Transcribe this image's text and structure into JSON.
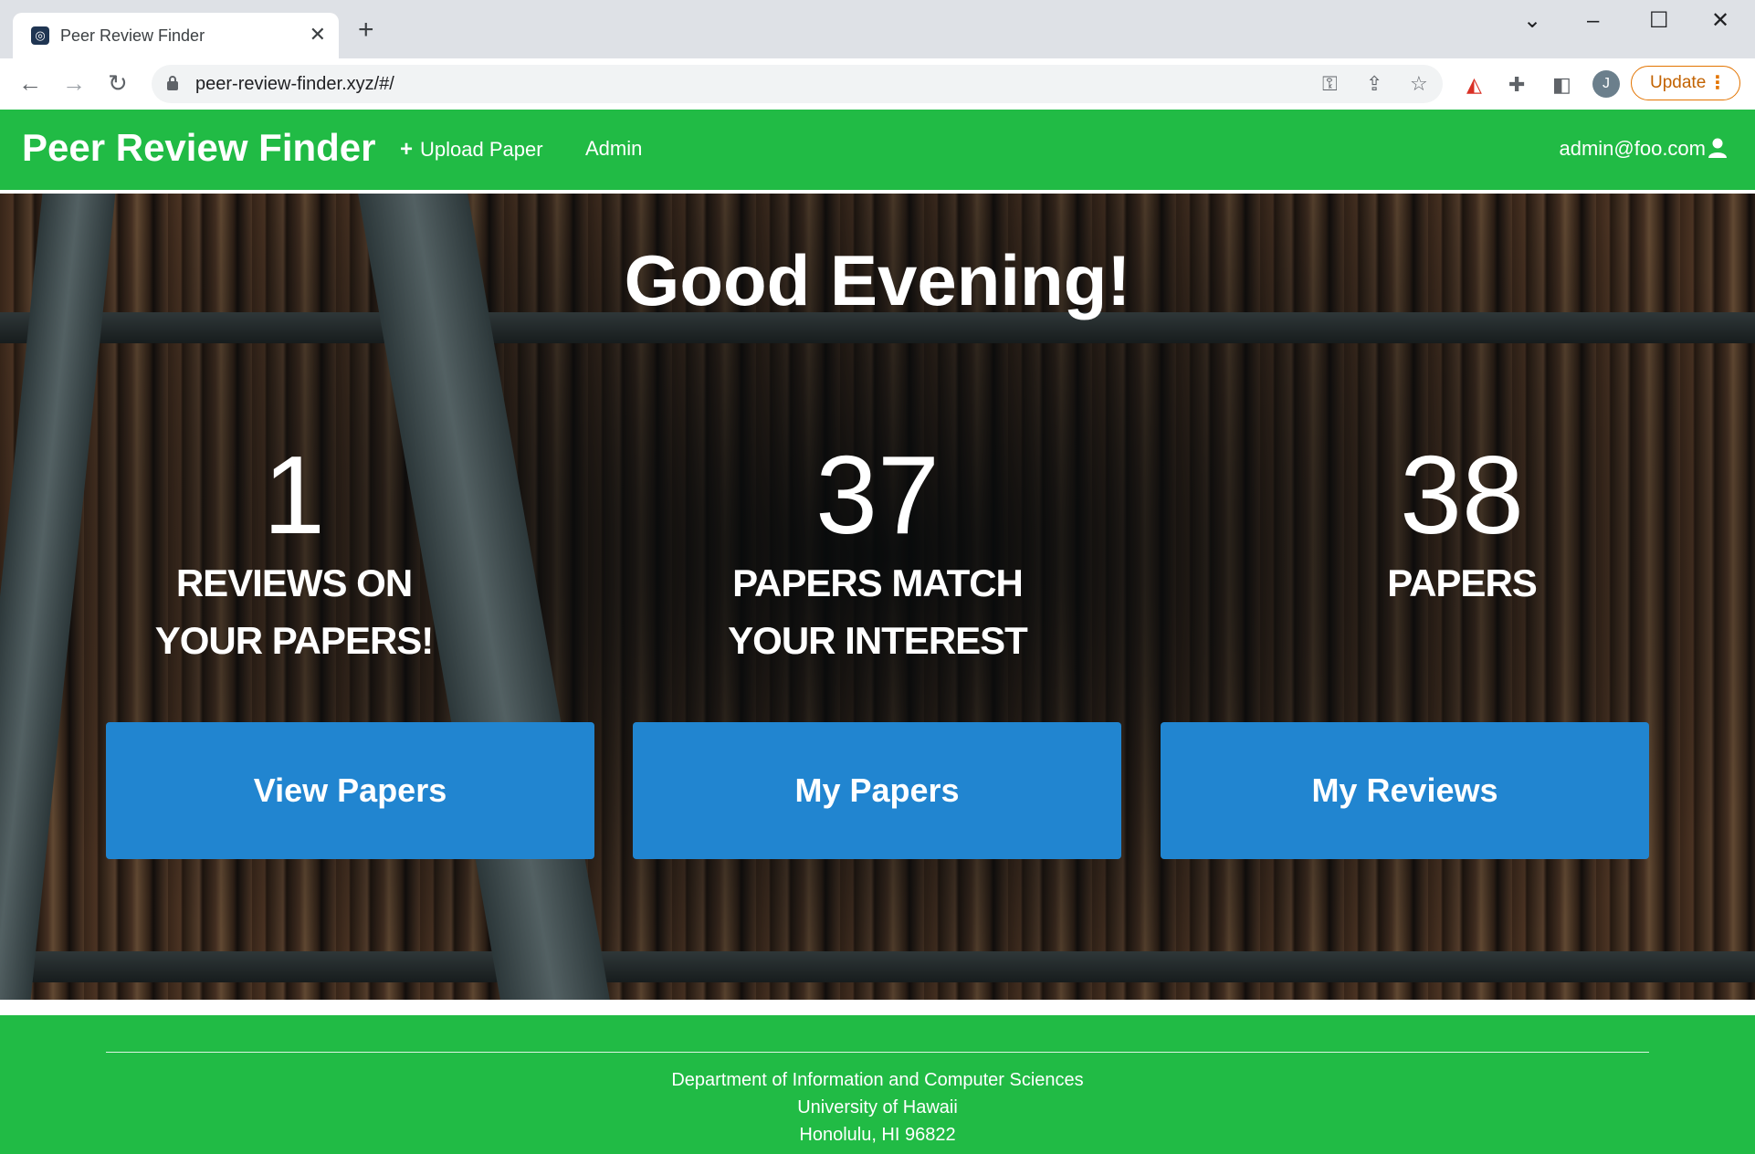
{
  "browser": {
    "tab_title": "Peer Review Finder",
    "tab_close": "✕",
    "new_tab": "+",
    "url": "peer-review-finder.xyz/#/",
    "profile_initial": "J",
    "update_label": "Update",
    "icons": [
      "back-icon",
      "forward-icon",
      "reload-icon",
      "lock-icon",
      "key-icon",
      "share-icon",
      "star-icon",
      "extension-icon",
      "puzzle-icon",
      "sidepanel-icon",
      "menu-icon"
    ]
  },
  "navbar": {
    "brand": "Peer Review Finder",
    "upload_label": "Upload Paper",
    "admin_label": "Admin",
    "user_email": "admin@foo.com"
  },
  "hero": {
    "greeting": "Good Evening!",
    "stats": [
      {
        "number": "1",
        "label_line1": "REVIEWS ON",
        "label_line2": "YOUR PAPERS!"
      },
      {
        "number": "37",
        "label_line1": "PAPERS MATCH",
        "label_line2": "YOUR INTEREST"
      },
      {
        "number": "38",
        "label_line1": "PAPERS",
        "label_line2": ""
      }
    ],
    "buttons": {
      "view_papers": "View Papers",
      "my_papers": "My Papers",
      "my_reviews": "My Reviews"
    }
  },
  "footer": {
    "line1": "Department of Information and Computer Sciences",
    "line2": "University of Hawaii",
    "line3": "Honolulu, HI 96822"
  },
  "colors": {
    "brand_green": "#21bb45",
    "button_blue": "#2185d0",
    "update_orange": "#e37400"
  }
}
